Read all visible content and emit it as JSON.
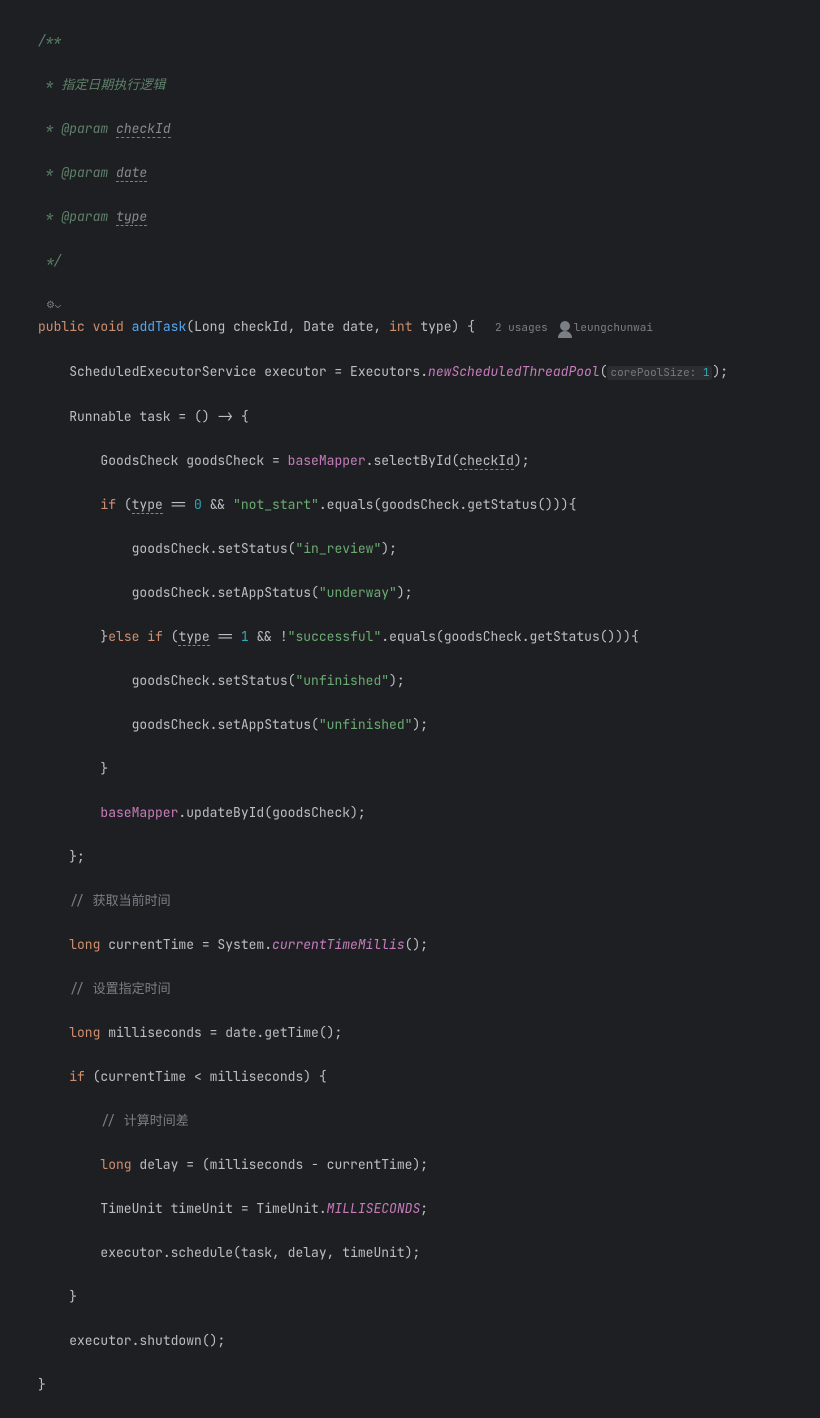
{
  "doc": {
    "start": "/**",
    "desc": " * 指定日期执行逻辑",
    "p1_tag": " * @param ",
    "p1_name": "checkId",
    "p2_tag": " * @param ",
    "p2_name": "date",
    "p3_tag": " * @param ",
    "p3_name": "type",
    "end": " */"
  },
  "sig": {
    "public": "public",
    "void": "void",
    "name": "addTask",
    "lp": "(",
    "p1t": "Long ",
    "p1n": "checkId",
    "c1": ", ",
    "p2t": "Date ",
    "p2n": "date",
    "c2": ", ",
    "p3t": "int",
    "p3n": " type",
    "rp": ")",
    "lb": " {",
    "usages": "2 usages",
    "author": "leungchunwai"
  },
  "l1": {
    "type": "ScheduledExecutorService ",
    "var": "executor",
    "eq": " = ",
    "cls": "Executors",
    "dot": ".",
    "m": "newScheduledThreadPool",
    "lp": "(",
    "hint": "corePoolSize: ",
    "val": "1",
    "rp": ")",
    "semi": ";"
  },
  "l2": {
    "type": "Runnable ",
    "var": "task",
    "eq": " = ",
    "lp": "()",
    "arrow": " -> ",
    "lb": "{"
  },
  "l3": {
    "type": "GoodsCheck ",
    "var": "goodsCheck",
    "eq": " = ",
    "f": "baseMapper",
    "dot": ".",
    "m": "selectById",
    "lp": "(",
    "arg": "checkId",
    "rp": ")",
    "semi": ";"
  },
  "l4": {
    "if": "if",
    "lp": " (",
    "v": "type",
    "eqeq": " == ",
    "n": "0",
    "and": " && ",
    "s": "\"not_start\"",
    "dot": ".",
    "m": "equals",
    "lp2": "(",
    "gc": "goodsCheck",
    "dot2": ".",
    "m2": "getStatus",
    "lp3": "()",
    "rp3": ")",
    "rp2": ")",
    "lb": "{"
  },
  "l5": {
    "gc": "goodsCheck",
    "dot": ".",
    "m": "setStatus",
    "lp": "(",
    "s": "\"in_review\"",
    "rp": ")",
    "semi": ";"
  },
  "l6": {
    "gc": "goodsCheck",
    "dot": ".",
    "m": "setAppStatus",
    "lp": "(",
    "s": "\"underway\"",
    "rp": ")",
    "semi": ";"
  },
  "l7": {
    "rb": "}",
    "else": "else",
    "if": " if",
    "lp": " (",
    "v": "type",
    "eqeq": " == ",
    "n": "1",
    "and": " && !",
    "s": "\"successful\"",
    "dot": ".",
    "m": "equals",
    "lp2": "(",
    "gc": "goodsCheck",
    "dot2": ".",
    "m2": "getStatus",
    "lp3": "()",
    "rp3": ")",
    "rp2": ")",
    "lb": "{"
  },
  "l8": {
    "gc": "goodsCheck",
    "dot": ".",
    "m": "setStatus",
    "lp": "(",
    "s": "\"unfinished\"",
    "rp": ")",
    "semi": ";"
  },
  "l9": {
    "gc": "goodsCheck",
    "dot": ".",
    "m": "setAppStatus",
    "lp": "(",
    "s": "\"unfinished\"",
    "rp": ")",
    "semi": ";"
  },
  "l10": {
    "rb": "}"
  },
  "l11": {
    "f": "baseMapper",
    "dot": ".",
    "m": "updateById",
    "lp": "(",
    "arg": "goodsCheck",
    "rp": ")",
    "semi": ";"
  },
  "l12": {
    "rb": "}",
    "semi": ";"
  },
  "c1": "// 获取当前时间",
  "l13": {
    "long": "long",
    "var": " currentTime",
    "eq": " = ",
    "cls": "System",
    "dot": ".",
    "m": "currentTimeMillis",
    "lp": "()",
    "semi": ";"
  },
  "c2": "// 设置指定时间",
  "l14": {
    "long": "long",
    "var": " milliseconds",
    "eq": " = ",
    "d": "date",
    "dot": ".",
    "m": "getTime",
    "lp": "()",
    "semi": ";"
  },
  "l15": {
    "if": "if",
    "lp": " (",
    "v1": "currentTime",
    "lt": " < ",
    "v2": "milliseconds",
    "rp": ")",
    "lb": " {"
  },
  "c3": "// 计算时间差",
  "l16": {
    "long": "long",
    "var": " delay",
    "eq": " = ",
    "lp": "(",
    "v1": "milliseconds",
    "minus": " - ",
    "v2": "currentTime",
    "rp": ")",
    "semi": ";"
  },
  "l17": {
    "type": "TimeUnit ",
    "var": "timeUnit",
    "eq": " = ",
    "cls": "TimeUnit",
    "dot": ".",
    "c": "MILLISECONDS",
    "semi": ";"
  },
  "l18": {
    "e": "executor",
    "dot": ".",
    "m": "schedule",
    "lp": "(",
    "a1": "task",
    "c1": ", ",
    "a2": "delay",
    "c2": ", ",
    "a3": "timeUnit",
    "rp": ")",
    "semi": ";"
  },
  "l19": {
    "rb": "}"
  },
  "l20": {
    "e": "executor",
    "dot": ".",
    "m": "shutdown",
    "lp": "()",
    "semi": ";"
  },
  "l21": {
    "rb": "}"
  },
  "gutter": "⚙⌄"
}
